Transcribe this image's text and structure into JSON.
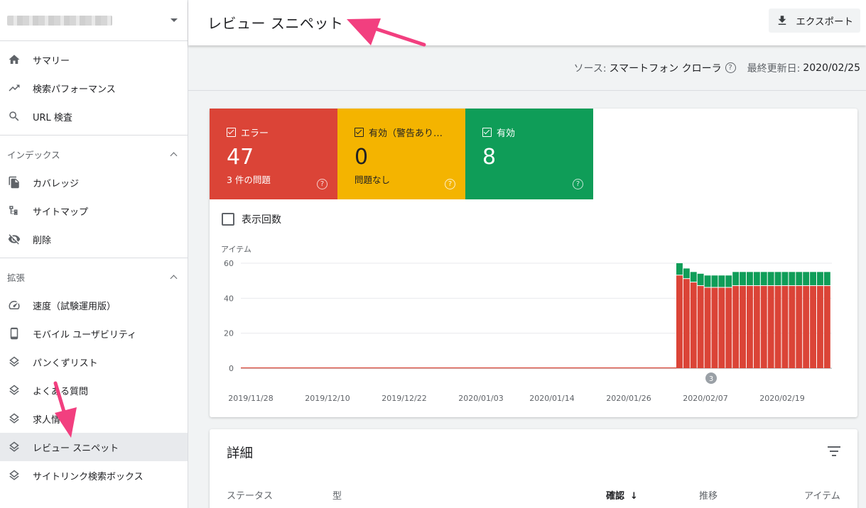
{
  "sidebar": {
    "top_items": [
      {
        "label": "サマリー",
        "icon": "home-icon"
      },
      {
        "label": "検索パフォーマンス",
        "icon": "trending-up-icon"
      },
      {
        "label": "URL 検査",
        "icon": "search-icon"
      }
    ],
    "index_section": {
      "title": "インデックス",
      "items": [
        {
          "label": "カバレッジ",
          "icon": "copy-icon"
        },
        {
          "label": "サイトマップ",
          "icon": "sitemap-icon"
        },
        {
          "label": "削除",
          "icon": "eye-off-icon"
        }
      ]
    },
    "enhancements_section": {
      "title": "拡張",
      "items": [
        {
          "label": "速度（試験運用版）",
          "icon": "speedometer-icon"
        },
        {
          "label": "モバイル ユーザビリティ",
          "icon": "phone-icon"
        },
        {
          "label": "パンくずリスト",
          "icon": "layers-icon"
        },
        {
          "label": "よくある質問",
          "icon": "layers-icon"
        },
        {
          "label": "求人情報",
          "icon": "layers-icon"
        },
        {
          "label": "レビュー スニペット",
          "icon": "layers-icon",
          "active": true
        },
        {
          "label": "サイトリンク検索ボックス",
          "icon": "layers-icon"
        }
      ]
    }
  },
  "header": {
    "title": "レビュー スニペット",
    "export_label": "エクスポート"
  },
  "source_bar": {
    "source_label": "ソース:",
    "source_value": "スマートフォン クローラ",
    "updated_label": "最終更新日:",
    "updated_value": "2020/02/25"
  },
  "tiles": [
    {
      "label": "エラー",
      "value": "47",
      "sub": "3 件の問題",
      "color": "#db4437"
    },
    {
      "label": "有効（警告あり…",
      "value": "0",
      "sub": "問題なし",
      "color": "#f4b400"
    },
    {
      "label": "有効",
      "value": "8",
      "sub": "",
      "color": "#0f9d58"
    }
  ],
  "impressions_label": "表示回数",
  "chart_data": {
    "type": "bar",
    "stacked": true,
    "ylabel": "アイテム",
    "ylim": [
      0,
      60
    ],
    "yticks": [
      0,
      20,
      40,
      60
    ],
    "xtick_labels": [
      "2019/11/28",
      "2019/12/10",
      "2019/12/22",
      "2020/01/03",
      "2020/01/14",
      "2020/01/26",
      "2020/02/07",
      "2020/02/19"
    ],
    "event_marker": "3",
    "series": [
      {
        "name": "エラー",
        "color": "#db4437",
        "values": [
          53,
          51,
          49,
          47,
          46,
          46,
          46,
          46,
          47,
          47,
          47,
          47,
          47,
          47,
          47,
          47,
          47,
          47,
          47,
          47,
          47,
          47
        ]
      },
      {
        "name": "有効",
        "color": "#0f9d58",
        "values": [
          7,
          6,
          6,
          7,
          7,
          7,
          7,
          7,
          8,
          8,
          8,
          8,
          8,
          8,
          8,
          8,
          8,
          8,
          8,
          8,
          8,
          8
        ]
      }
    ]
  },
  "details": {
    "title": "詳細",
    "columns": [
      "ステータス",
      "型",
      "確認",
      "推移",
      "アイテム"
    ],
    "sort_arrow": "↓"
  }
}
